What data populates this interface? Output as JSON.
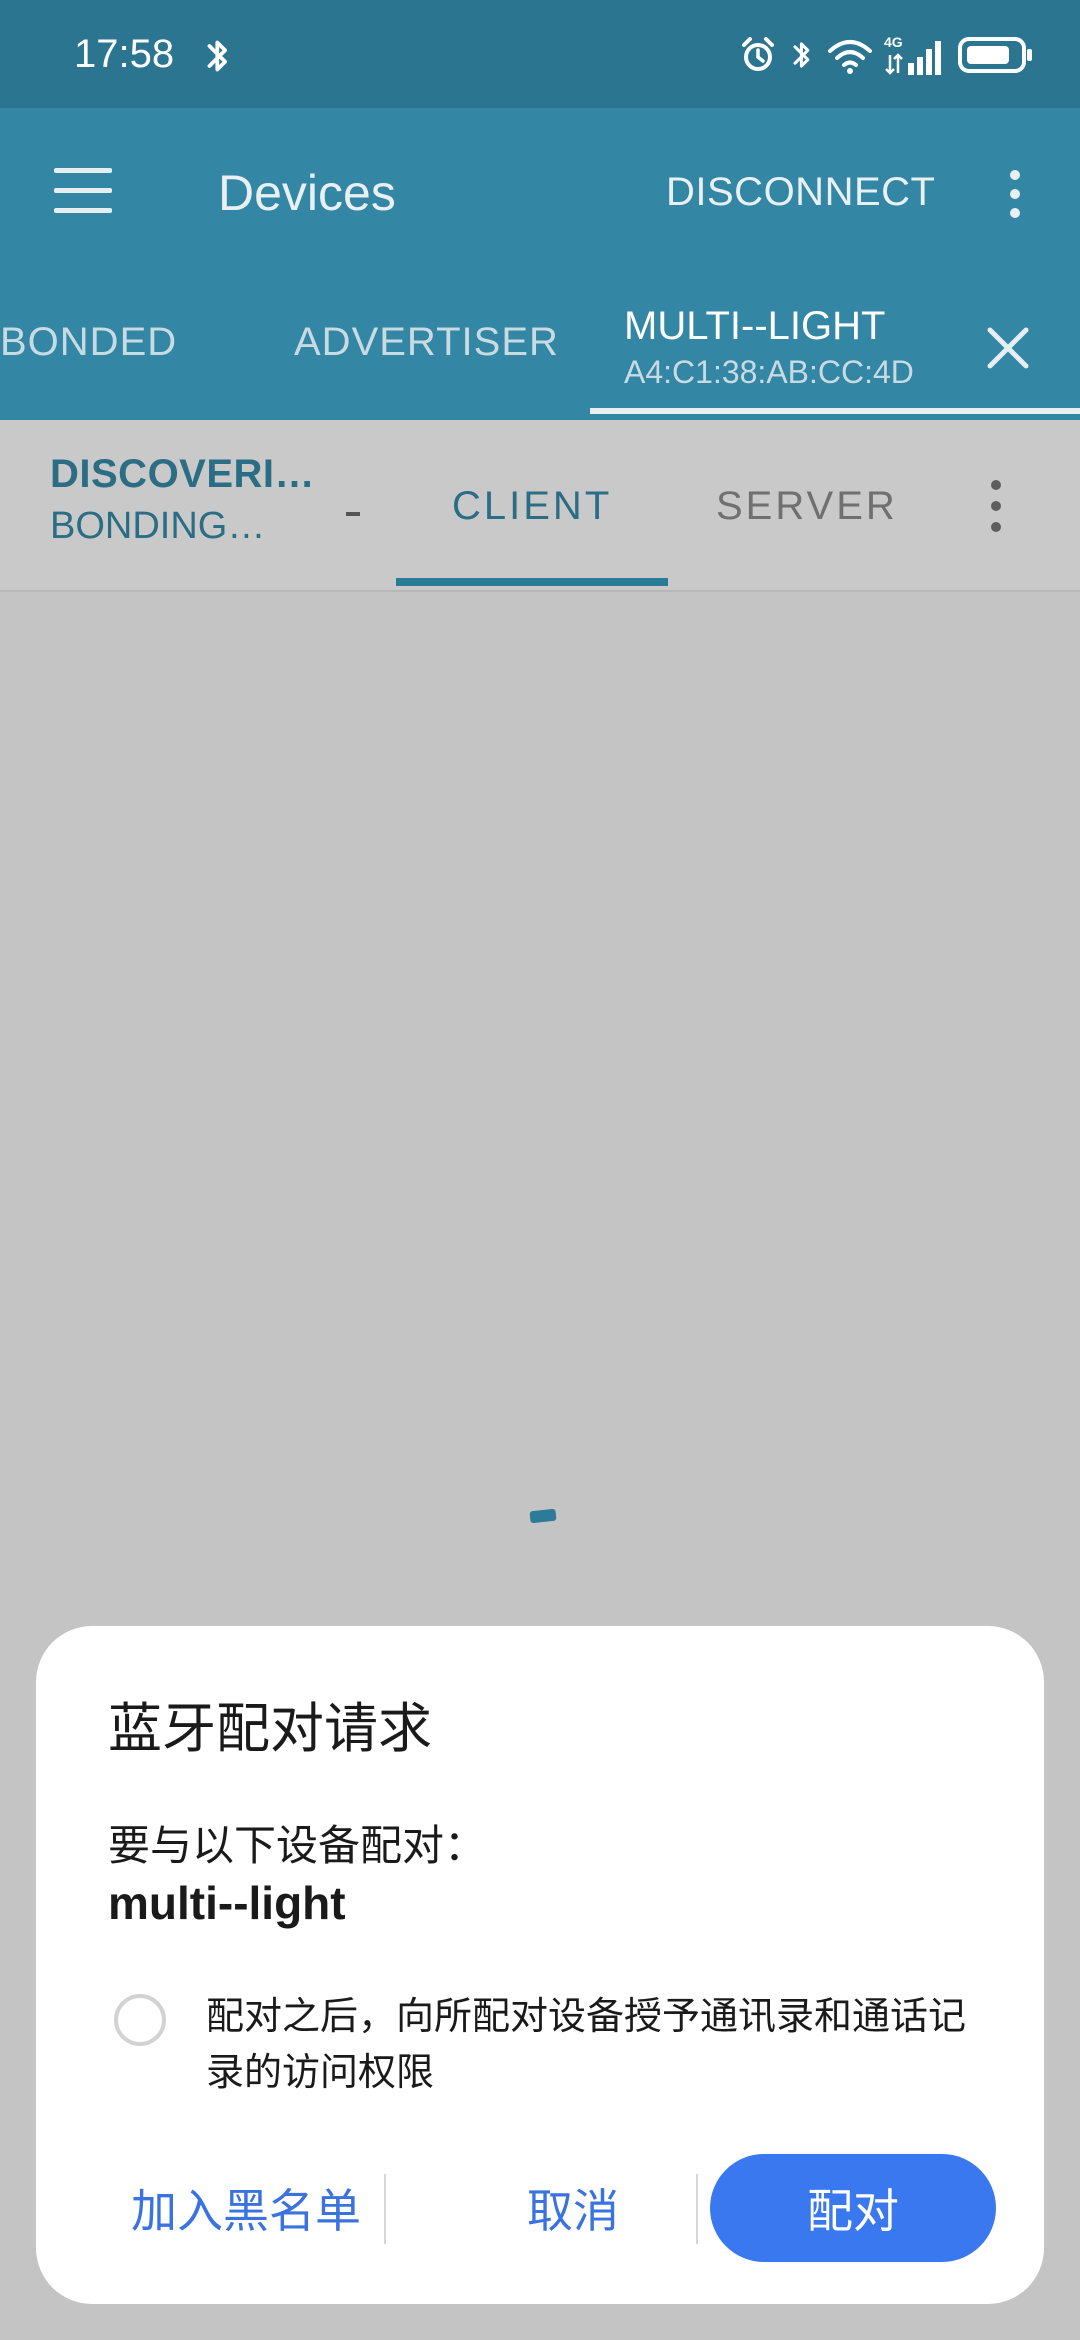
{
  "status_bar": {
    "time": "17:58",
    "icons": [
      "bluetooth-icon",
      "alarm-icon",
      "bluetooth-icon",
      "wifi-icon",
      "4g-signal-icon",
      "battery-icon"
    ],
    "network_label": "4G"
  },
  "app_bar": {
    "title": "Devices",
    "action": "DISCONNECT",
    "colors": {
      "status_bg": "#2b7590",
      "app_bg": "#3386a4"
    }
  },
  "device_tabs": {
    "items": [
      "BONDED",
      "ADVERTISER"
    ],
    "active": {
      "name": "MULTI--LIGHT",
      "address": "A4:C1:38:AB:CC:4D"
    }
  },
  "sub_bar": {
    "status_line1": "DISCOVERI…",
    "status_line2": "BONDING…",
    "tabs": [
      "CLIENT",
      "SERVER"
    ],
    "selected_tab": "CLIENT"
  },
  "dialog": {
    "title": "蓝牙配对请求",
    "message": "要与以下设备配对：",
    "device_name": "multi--light",
    "permission_text": "配对之后，向所配对设备授予通讯录和通话记录的访问权限",
    "permission_checked": false,
    "buttons": {
      "block": "加入黑名单",
      "cancel": "取消",
      "pair": "配对"
    },
    "colors": {
      "accent": "#3a78f0"
    }
  }
}
